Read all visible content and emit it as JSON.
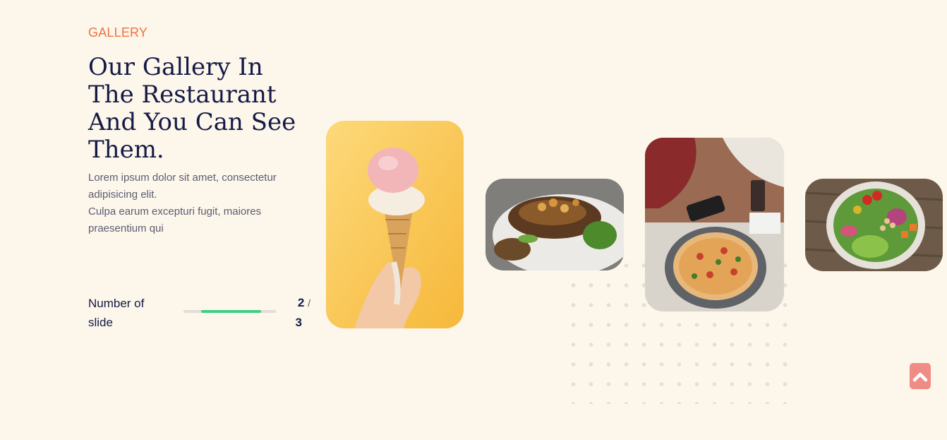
{
  "gallery": {
    "eyebrow": "GALLERY",
    "title": "Our Gallery In The Restaurant And You Can See Them.",
    "description_lines": [
      "Lorem ipsum dolor sit amet, consectetur adipisicing elit.",
      "Culpa earum excepturi fugit, maiores praesentium qui"
    ]
  },
  "slider": {
    "counter_label": "Number of slide",
    "current": "2",
    "separator": "/",
    "total": "3",
    "progress_fraction": 0.67
  },
  "colors": {
    "background": "#fdf6ea",
    "accent": "#f0713f",
    "heading": "#141a46",
    "progress": "#3ecf84",
    "scroll_button": "#f08c86"
  },
  "icons": {
    "scroll_top": "chevron-up-icon"
  }
}
